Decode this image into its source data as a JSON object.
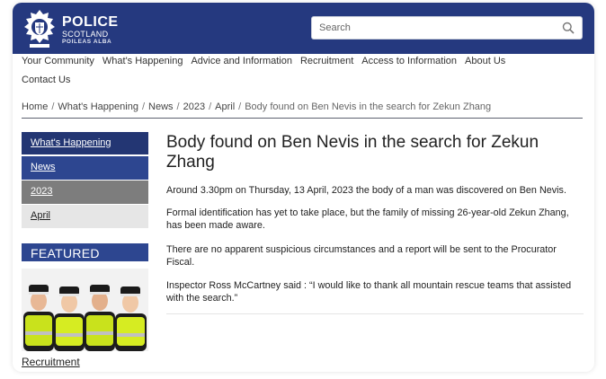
{
  "header": {
    "brand_line1": "POLICE",
    "brand_line2": "SCOTLAND",
    "brand_line3": "POILEAS ALBA",
    "search_placeholder": "Search",
    "bg_color": "#25397f"
  },
  "icons": {
    "crest": "police-crest-icon",
    "search": "search-icon"
  },
  "nav": {
    "row1": [
      "Your Community",
      "What's Happening",
      "Advice and Information",
      "Recruitment",
      "Access to Information",
      "About Us"
    ],
    "row2": [
      "Contact Us"
    ]
  },
  "breadcrumb": {
    "items": [
      "Home",
      "What's Happening",
      "News",
      "2023",
      "April"
    ],
    "current": "Body found on Ben Nevis in the search for Zekun Zhang",
    "separator": "/"
  },
  "sidebar": {
    "items": [
      "What's Happening",
      "News",
      "2023",
      "April"
    ],
    "featured_label": "FEATURED",
    "featured_link": "Recruitment"
  },
  "article": {
    "title": "Body found on Ben Nevis in the search for Zekun Zhang",
    "paragraphs": [
      "Around 3.30pm on Thursday, 13 April, 2023 the body of a man was discovered on Ben Nevis.",
      "Formal identification has yet to take place, but the family of missing 26-year-old Zekun Zhang, has been made aware.",
      "There are no apparent suspicious circumstances and a report will be sent to the Procurator Fiscal.",
      "Inspector Ross McCartney said : “I would like to thank all mountain rescue teams that assisted with the search.”"
    ]
  }
}
